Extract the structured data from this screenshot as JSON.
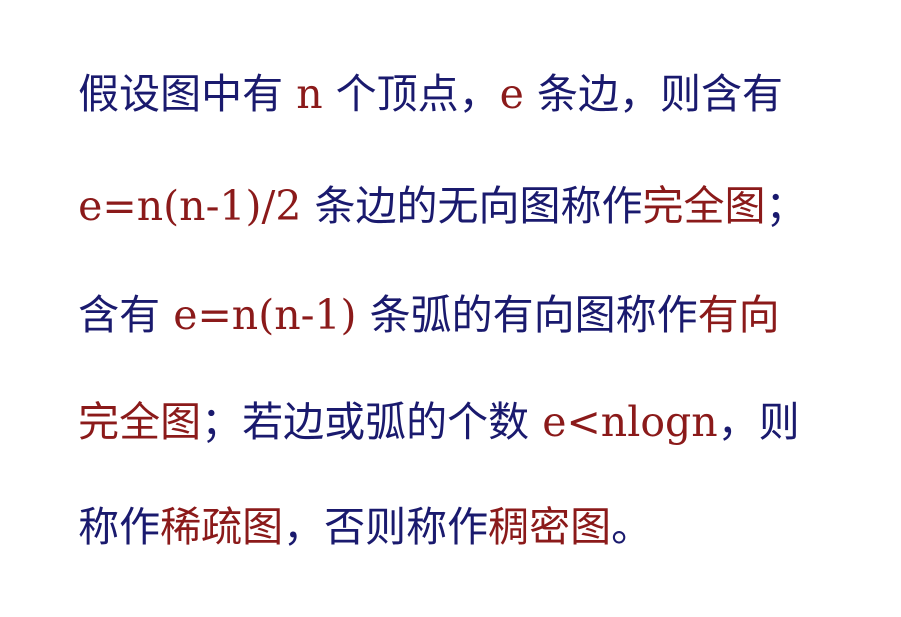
{
  "colors": {
    "text_blue": "#1a1a6e",
    "text_red": "#8b1a1a",
    "background": "#ffffff"
  },
  "lines": [
    {
      "segments": [
        {
          "text": "假设图中有 ",
          "color": "blue"
        },
        {
          "text": "n",
          "color": "red"
        },
        {
          "text": " 个顶点，",
          "color": "blue"
        },
        {
          "text": "e",
          "color": "red"
        },
        {
          "text": " 条边，则含有",
          "color": "blue"
        }
      ]
    },
    {
      "segments": [
        {
          "text": "e=n(n-1)/2",
          "color": "red"
        },
        {
          "text": " 条边的无向图称作",
          "color": "blue"
        },
        {
          "text": "完全图",
          "color": "red"
        },
        {
          "text": "；",
          "color": "blue"
        }
      ]
    },
    {
      "segments": [
        {
          "text": "含有 ",
          "color": "blue"
        },
        {
          "text": "e=n(n-1)",
          "color": "red"
        },
        {
          "text": " 条弧的有向图称作",
          "color": "blue"
        },
        {
          "text": "有向",
          "color": "red"
        }
      ]
    },
    {
      "segments": [
        {
          "text": "完全图",
          "color": "red"
        },
        {
          "text": "；若边或弧的个数 ",
          "color": "blue"
        },
        {
          "text": "e<nlogn",
          "color": "red"
        },
        {
          "text": "，则",
          "color": "blue"
        }
      ]
    },
    {
      "segments": [
        {
          "text": "称作",
          "color": "blue"
        },
        {
          "text": "稀疏图",
          "color": "red"
        },
        {
          "text": "，否则称作",
          "color": "blue"
        },
        {
          "text": "稠密图",
          "color": "red"
        },
        {
          "text": "。",
          "color": "blue"
        }
      ]
    }
  ]
}
